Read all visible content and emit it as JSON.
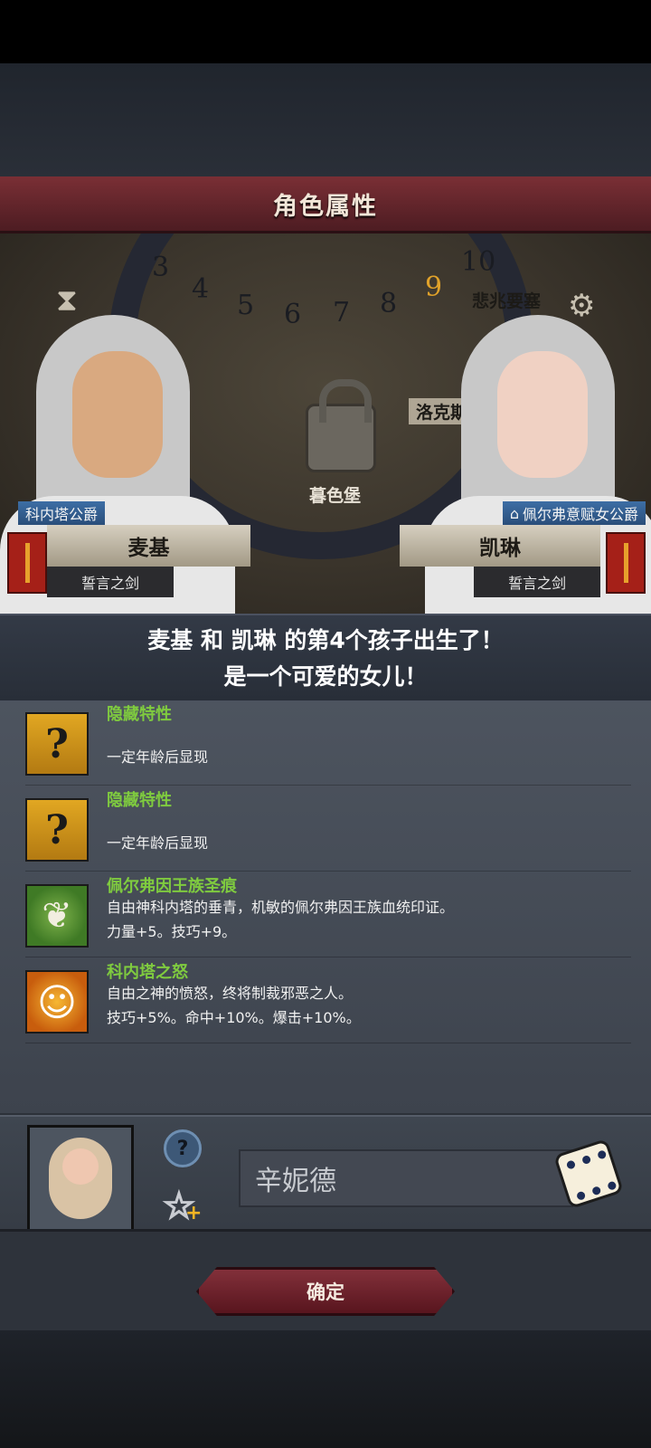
{
  "header": {
    "title": "角色属性"
  },
  "map": {
    "dial_numbers": [
      "3",
      "4",
      "5",
      "6",
      "7",
      "8",
      "9",
      "10"
    ],
    "active_number": "9",
    "labels": {
      "castle_north": "洛克斯堡",
      "castle_center": "暮色堡",
      "fort_top": "悲兆要塞"
    }
  },
  "parents": {
    "left": {
      "title": "科内塔公爵",
      "name": "麦基",
      "motto": "誓言之剑"
    },
    "right": {
      "title": "佩尔弗意赋女公爵",
      "name": "凯琳",
      "motto": "誓言之剑"
    }
  },
  "announcement": {
    "line1": "麦基 和 凯琳 的第4个孩子出生了！",
    "line2": "是一个可爱的女儿！"
  },
  "traits": [
    {
      "name": "隐藏特性",
      "desc1": "一定年龄后显现",
      "desc2": "",
      "icon": "question-icon"
    },
    {
      "name": "隐藏特性",
      "desc1": "一定年龄后显现",
      "desc2": "",
      "icon": "question-icon"
    },
    {
      "name": "佩尔弗因王族圣痕",
      "desc1": "自由神科内塔的垂青，机敏的佩尔弗因王族血统印证。",
      "desc2": "力量+5。技巧+9。",
      "icon": "feather-icon"
    },
    {
      "name": "科内塔之怒",
      "desc1": "自由之神的愤怒，终将制裁邪恶之人。",
      "desc2": "技巧+5%。命中+10%。爆击+10%。",
      "icon": "sun-face-icon"
    }
  ],
  "child": {
    "name_value": "辛妮德",
    "help_glyph": "?"
  },
  "footer": {
    "confirm_label": "确定"
  }
}
